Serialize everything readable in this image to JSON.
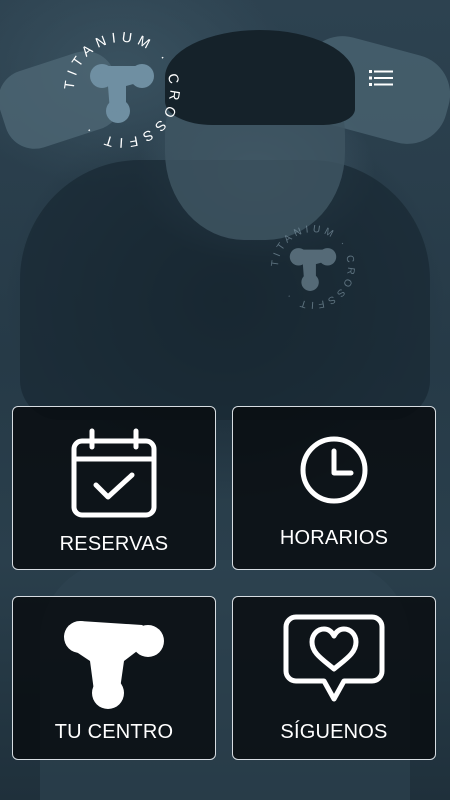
{
  "brand": {
    "ring_text": "TITANIUM · CROSSFIT ·",
    "accent": "#6f8fa2"
  },
  "header": {
    "menu_icon": "list-icon"
  },
  "tiles": [
    {
      "label": "RESERVAS",
      "icon": "calendar-check-icon"
    },
    {
      "label": "HORARIOS",
      "icon": "clock-icon"
    },
    {
      "label": "TU CENTRO",
      "icon": "titanium-logo-icon"
    },
    {
      "label": "SÍGUENOS",
      "icon": "heart-chat-icon"
    }
  ],
  "colors": {
    "tile_background": "#0b1015",
    "tile_border": "#d7dde2",
    "text": "#ffffff"
  }
}
